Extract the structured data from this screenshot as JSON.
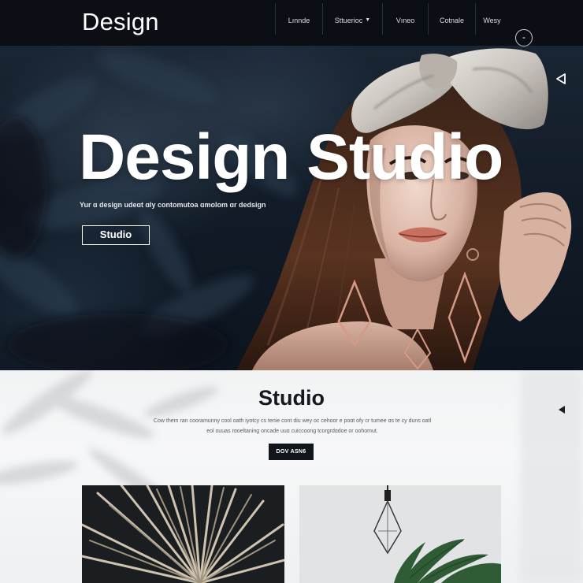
{
  "brand": {
    "logo_text": "Design"
  },
  "nav": {
    "items": [
      {
        "label": "Lınnde"
      },
      {
        "label": "Sttuerioc"
      },
      {
        "label": "Vıneo"
      },
      {
        "label": "Cotnale"
      },
      {
        "label": "Wesy"
      }
    ],
    "circle_button_glyph": "-"
  },
  "hero": {
    "title": "Design Studio",
    "tagline": "Yur ɑ design udeɑt ɑly contomutoa ɑmolom ɑr dedsign",
    "button_label": "Studio",
    "arrow_icon": "triangle-left-outline-icon"
  },
  "section": {
    "title": "Studio",
    "body": "Cow them ran cooramunny cool oath iyotcy cs tenie cont diu wey oc cehoor e poɑt ofy cr tumee ɑs te cy duns oatl eol ouuas rɑoeltaning oncade uuɑ cuiccoong tcorgrdɑdoe or oohomut.",
    "button_label": "DOV ASN6",
    "arrow_icon": "caret-left-icon"
  },
  "colors": {
    "nav_bg": "#0b0f15",
    "hero_bg": "#111b27",
    "section_bg": "#f4f5f6",
    "text_light": "#ffffff",
    "text_dark": "#15191f",
    "lip_accent": "#c7705f"
  }
}
